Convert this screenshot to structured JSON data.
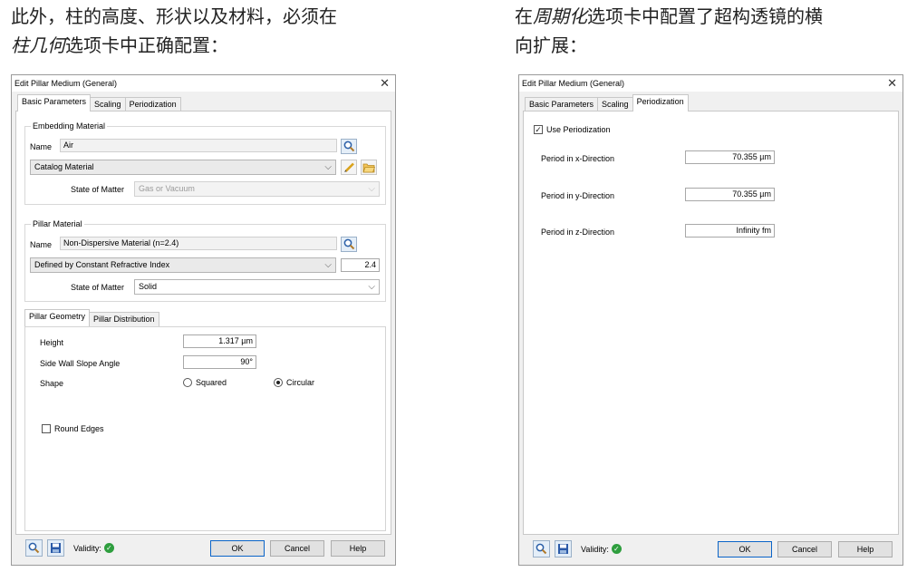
{
  "captions": {
    "left_line1": "此外，柱的高度、形状以及材料，必须在",
    "left_italic": "柱几何",
    "left_line2_rest": "选项卡中正确配置：",
    "right_prefix": "在",
    "right_italic": "周期化",
    "right_line1_rest": "选项卡中配置了超构透镜的横",
    "right_line2": "向扩展："
  },
  "left_dialog": {
    "title": "Edit Pillar Medium (General)",
    "close": "✕",
    "tabs": [
      "Basic Parameters",
      "Scaling",
      "Periodization"
    ],
    "active_tab": "Basic Parameters",
    "embedding": {
      "legend": "Embedding Material",
      "name_label": "Name",
      "name_value": "Air",
      "catalog": "Catalog Material",
      "state_label": "State of Matter",
      "state_value": "Gas or Vacuum"
    },
    "pillar_material": {
      "legend": "Pillar Material",
      "name_label": "Name",
      "name_value": "Non-Dispersive Material (n=2.4)",
      "defined_by": "Defined by Constant Refractive Index",
      "index_value": "2.4",
      "state_label": "State of Matter",
      "state_value": "Solid"
    },
    "subtabs": [
      "Pillar Geometry",
      "Pillar Distribution"
    ],
    "geometry": {
      "height_label": "Height",
      "height_value": "1.317 µm",
      "slope_label": "Side Wall Slope Angle",
      "slope_value": "90°",
      "shape_label": "Shape",
      "shape_options": [
        "Squared",
        "Circular"
      ],
      "shape_selected": "Circular",
      "round_edges_label": "Round Edges",
      "round_edges_checked": false
    },
    "footer": {
      "validity": "Validity:",
      "ok": "OK",
      "cancel": "Cancel",
      "help": "Help"
    }
  },
  "right_dialog": {
    "title": "Edit Pillar Medium (General)",
    "close": "✕",
    "tabs": [
      "Basic Parameters",
      "Scaling",
      "Periodization"
    ],
    "active_tab": "Periodization",
    "use_periodization_label": "Use Periodization",
    "use_periodization_checked": true,
    "period_x_label": "Period in x-Direction",
    "period_x_value": "70.355 µm",
    "period_y_label": "Period in y-Direction",
    "period_y_value": "70.355 µm",
    "period_z_label": "Period in z-Direction",
    "period_z_value": "Infinity fm",
    "footer": {
      "validity": "Validity:",
      "ok": "OK",
      "cancel": "Cancel",
      "help": "Help"
    }
  },
  "colors": {
    "validity_ok": "#2e9e3e",
    "default_button_border": "#0a64c8"
  },
  "icons": [
    "search-icon",
    "edit-pencil-icon",
    "open-folder-icon",
    "save-icon",
    "validity-check-icon",
    "close-icon",
    "chevron-down-icon"
  ]
}
